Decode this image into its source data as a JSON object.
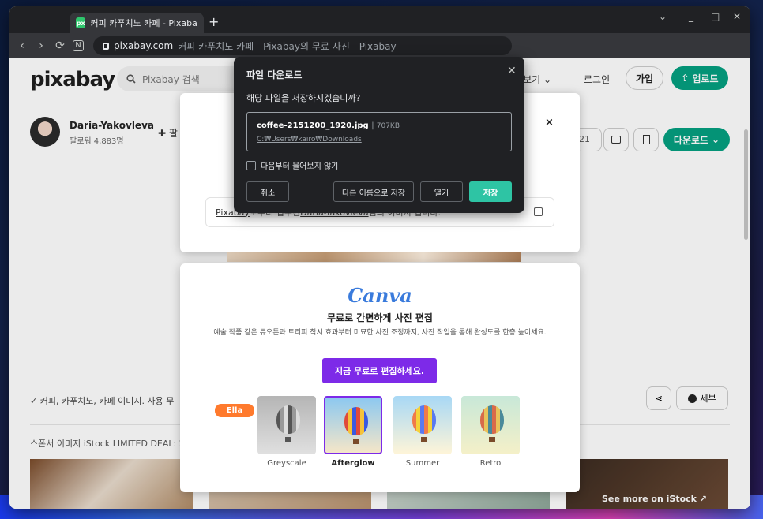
{
  "browser": {
    "tab_title": "커피 카푸치노 카페 - Pixabay의",
    "favicon_text": "px",
    "new_tab": "+",
    "url_host": "pixabay.com",
    "url_rest": "커피 카푸치노 카페 - Pixabay의 무료 사진 - Pixabay",
    "window_controls": {
      "dropdown": "⌄",
      "minimize": "_",
      "maximize": "□",
      "close": "✕"
    },
    "nav": {
      "back": "‹",
      "forward": "›",
      "reload": "⟳",
      "note": "N"
    }
  },
  "header": {
    "logo": "pixabay",
    "search_placeholder": "Pixabay 검색",
    "explore": "둘러보기 ⌄",
    "login": "로그인",
    "join": "가입",
    "upload": "업로드"
  },
  "author": {
    "name": "Daria-Yakovleva",
    "followers": "팔로워 4,883명",
    "follow_fragment": "팔"
  },
  "actions": {
    "likes_fragment": "21",
    "download": "다운로드"
  },
  "page": {
    "tags_line": "✓ 커피, 카푸치노, 카페 이미지. 사용 무",
    "detail": "세부",
    "sponsor": "스폰서 이미지 iStock LIMITED DEAL: 2",
    "see_more": "See more on iStock ↗"
  },
  "share_modal": {
    "close": "×",
    "credit_prefix": "Pixabay",
    "credit_middle": "로부터 입수된 ",
    "credit_author": "Daria-Yakovleva",
    "credit_suffix": "님의 이미지 입니다."
  },
  "canva": {
    "logo": "Canva",
    "title": "무료로 간편하게 사진 편집",
    "description": "예술 작품 같은 듀오톤과 트리피 착시 효과부터 미묘한 사진 조정까지, 사진 작업을 통해 완성도를 한층 높이세요.",
    "cta": "지금 무료로 편집하세요.",
    "cursor_label": "Ella",
    "filters": [
      {
        "label": "Greyscale"
      },
      {
        "label": "Afterglow"
      },
      {
        "label": "Summer"
      },
      {
        "label": "Retro"
      }
    ]
  },
  "download_dialog": {
    "title": "파일 다운로드",
    "close": "✕",
    "question": "해당 파일을 저장하시겠습니까?",
    "filename": "coffee-2151200_1920.jpg",
    "filesize": "707KB",
    "path": "C:₩Users₩kairo₩Downloads",
    "checkbox_label": "다음부터 물어보지 않기",
    "cancel": "취소",
    "save_as": "다른 이름으로 저장",
    "open": "열기",
    "save": "저장"
  },
  "colors": {
    "pixabay_green": "#05a081",
    "canva_purple": "#7d2ae8",
    "dialog_bg": "#202124",
    "save_teal": "#2ec4a4",
    "ella_orange": "#ff7a2d"
  }
}
